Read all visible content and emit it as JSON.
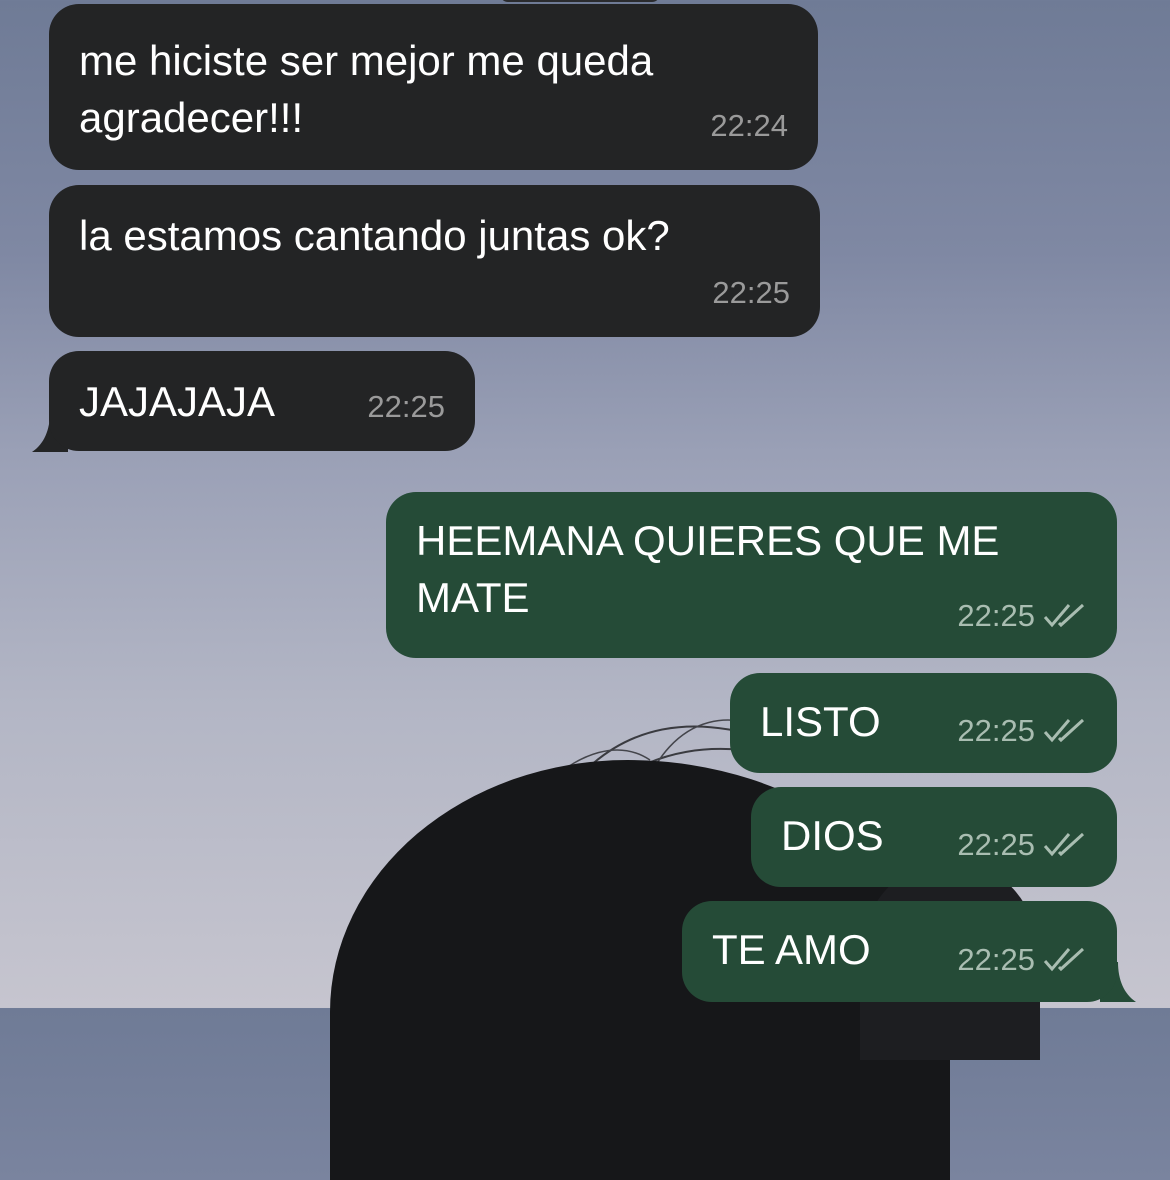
{
  "chat": {
    "colors": {
      "incoming_bubble": "#232425",
      "outgoing_bubble": "#254b37",
      "timestamp_incoming": "#9a9a9a",
      "timestamp_outgoing": "#a9bdb1"
    },
    "messages": [
      {
        "direction": "incoming",
        "text": "me hiciste ser mejor me queda agradecer!!!",
        "time": "22:24"
      },
      {
        "direction": "incoming",
        "text": "la estamos cantando juntas ok?",
        "time": "22:25"
      },
      {
        "direction": "incoming",
        "text": "JAJAJAJA",
        "time": "22:25"
      },
      {
        "direction": "outgoing",
        "text": "HEEMANA QUIERES QUE ME MATE",
        "time": "22:25",
        "status_icon": "double-check-icon"
      },
      {
        "direction": "outgoing",
        "text": "LISTO",
        "time": "22:25",
        "status_icon": "double-check-icon"
      },
      {
        "direction": "outgoing",
        "text": "DIOS",
        "time": "22:25",
        "status_icon": "double-check-icon"
      },
      {
        "direction": "outgoing",
        "text": "TE AMO",
        "time": "22:25",
        "status_icon": "double-check-icon"
      }
    ]
  }
}
